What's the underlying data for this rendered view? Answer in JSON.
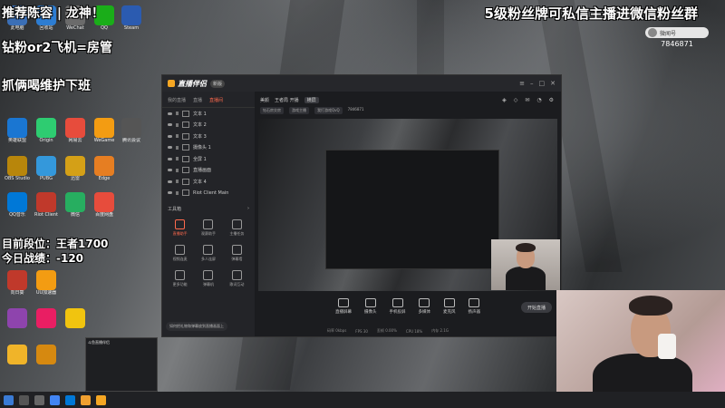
{
  "overlays": {
    "line1": "推荐陈容 | 龙神！",
    "line2": "钻粉or2飞机=房管",
    "line3": "抓俩喝维护下班",
    "line4": "目前段位：王者1700",
    "line5": "今日战绩：-120",
    "top_right": "5级粉丝牌可私信主播进微信粉丝群"
  },
  "identity": {
    "name": "微闻号",
    "number": "7846871"
  },
  "app": {
    "brand": "直播伴侣",
    "version": "新版",
    "left_tabs": [
      "我的直播",
      "直播",
      "直播间"
    ],
    "sources": [
      "文本 1",
      "文本 2",
      "文本 3",
      "摄像头 1",
      "全屏 1",
      "直播画面",
      "文本 4",
      "Riot Client Main"
    ],
    "tools_title": "工具箱",
    "tools": [
      {
        "label": "直播助手",
        "active": true
      },
      {
        "label": "观赛助手"
      },
      {
        "label": "主播任务"
      },
      {
        "label": "视频连麦"
      },
      {
        "label": "多人连屏"
      },
      {
        "label": "弹幕墙"
      },
      {
        "label": "更多功能"
      },
      {
        "label": "弹幕机"
      },
      {
        "label": "歌词互动"
      },
      {
        "label": "直播"
      }
    ],
    "tip": "如何把礼物和弹幕放到直播画面上",
    "header_title": "美颜",
    "header_user": "王者局 开播",
    "header_tag": "横屏",
    "header2_a": "钻石房交房",
    "header2_b": "游戏主播",
    "header2_c": "我打游戏QvQ",
    "header2_num": "7846871",
    "bottom_tools": [
      "直播屏幕",
      "摄像头",
      "手机投屏",
      "多媒体",
      "麦克风",
      "扬声器"
    ],
    "start_button": "开始直播",
    "status": [
      "码率 0kbps",
      "FPS 30",
      "丢帧 0.00%",
      "CPU 18%",
      "内存 2.1G"
    ]
  },
  "desktop_icons": [
    "此电脑",
    "回收站",
    "WeChat",
    "QQ",
    "Steam",
    "英雄联盟",
    "Origin",
    "网易云",
    "WeGame",
    "腾讯会议",
    "OBS Studio",
    "PUBG",
    "迅雷",
    "Edge",
    "QQ音乐",
    "Riot Client",
    "微信",
    "百度网盘",
    "向日葵",
    "UU加速器"
  ],
  "preview_title": "斗鱼直播伴侣",
  "colors": {
    "accent": "#ff6a4d",
    "app_bg": "#1f2023",
    "brand": "#f5a623"
  }
}
